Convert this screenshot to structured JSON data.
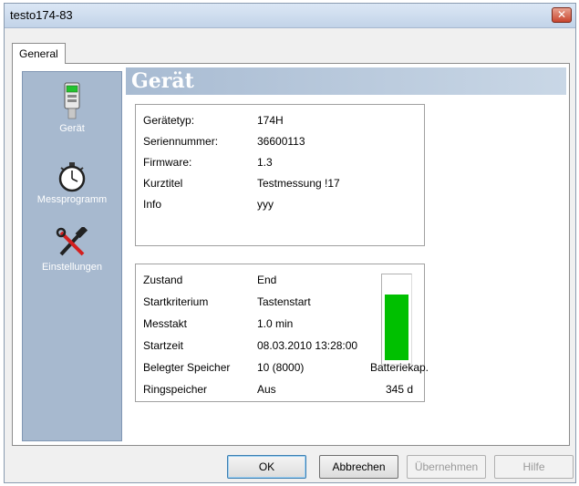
{
  "window": {
    "title": "testo174-83",
    "close_icon": "close-icon"
  },
  "tabs": [
    {
      "label": "General"
    }
  ],
  "sidebar": {
    "items": [
      {
        "label": "Gerät",
        "icon": "device-icon"
      },
      {
        "label": "Messprogramm",
        "icon": "stopwatch-icon"
      },
      {
        "label": "Einstellungen",
        "icon": "tools-icon"
      }
    ]
  },
  "header": {
    "title": "Gerät"
  },
  "device_info": [
    {
      "label": "Gerätetyp:",
      "value": "174H"
    },
    {
      "label": "Seriennummer:",
      "value": "36600113"
    },
    {
      "label": "Firmware:",
      "value": "1.3"
    },
    {
      "label": "Kurztitel",
      "value": "Testmessung !17"
    },
    {
      "label": "Info",
      "value": "yyy"
    }
  ],
  "status_info": [
    {
      "label": "Zustand",
      "value": "End"
    },
    {
      "label": "Startkriterium",
      "value": "Tastenstart"
    },
    {
      "label": "Messtakt",
      "value": "1.0 min"
    },
    {
      "label": "Startzeit",
      "value": "08.03.2010 13:28:00"
    },
    {
      "label": "Belegter Speicher",
      "value": "10 (8000)"
    },
    {
      "label": "Ringspeicher",
      "value": "Aus"
    }
  ],
  "battery": {
    "label": "Batteriekap.",
    "value": "345  d",
    "level_fraction": 0.8,
    "color": "#00c000"
  },
  "buttons": {
    "ok": "OK",
    "cancel": "Abbrechen",
    "apply": "Übernehmen",
    "help": "Hilfe"
  }
}
